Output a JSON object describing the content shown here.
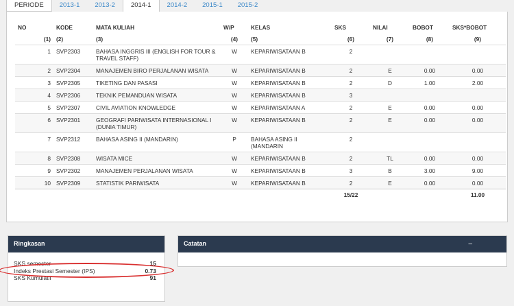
{
  "tabs": [
    "PERIODE",
    "2013-1",
    "2013-2",
    "2014-1",
    "2014-2",
    "2015-1",
    "2015-2"
  ],
  "active_tab": "2014-1",
  "table": {
    "headers": [
      "NO",
      "KODE",
      "MATA KULIAH",
      "W/P",
      "KELAS",
      "SKS",
      "NILAI",
      "BOBOT",
      "SKS*BOBOT"
    ],
    "subheaders": [
      "(1)",
      "(2)",
      "(3)",
      "(4)",
      "(5)",
      "(6)",
      "(7)",
      "(8)",
      "(9)"
    ],
    "rows": [
      {
        "no": "1",
        "kode": "SVP2303",
        "mk": "BAHASA INGGRIS III (ENGLISH FOR TOUR & TRAVEL STAFF)",
        "wp": "W",
        "kelas": "KEPARIWISATAAN B",
        "sks": "2",
        "nilai": "",
        "bobot": "",
        "sb": ""
      },
      {
        "no": "2",
        "kode": "SVP2304",
        "mk": "MANAJEMEN BIRO PERJALANAN WISATA",
        "wp": "W",
        "kelas": "KEPARIWISATAAN B",
        "sks": "2",
        "nilai": "E",
        "bobot": "0.00",
        "sb": "0.00"
      },
      {
        "no": "3",
        "kode": "SVP2305",
        "mk": "TIKETING DAN PASASI",
        "wp": "W",
        "kelas": "KEPARIWISATAAN B",
        "sks": "2",
        "nilai": "D",
        "bobot": "1.00",
        "sb": "2.00"
      },
      {
        "no": "4",
        "kode": "SVP2306",
        "mk": "TEKNIK PEMANDUAN WISATA",
        "wp": "W",
        "kelas": "KEPARIWISATAAN B",
        "sks": "3",
        "nilai": "",
        "bobot": "",
        "sb": ""
      },
      {
        "no": "5",
        "kode": "SVP2307",
        "mk": "CIVIL AVIATION KNOWLEDGE",
        "wp": "W",
        "kelas": "KEPARIWISATAAN A",
        "sks": "2",
        "nilai": "E",
        "bobot": "0.00",
        "sb": "0.00"
      },
      {
        "no": "6",
        "kode": "SVP2301",
        "mk": "GEOGRAFI PARIWISATA INTERNASIONAL I (DUNIA TIMUR)",
        "wp": "W",
        "kelas": "KEPARIWISATAAN B",
        "sks": "2",
        "nilai": "E",
        "bobot": "0.00",
        "sb": "0.00"
      },
      {
        "no": "7",
        "kode": "SVP2312",
        "mk": "BAHASA ASING II (MANDARIN)",
        "wp": "P",
        "kelas": "BAHASA ASING II (MANDARIN",
        "sks": "2",
        "nilai": "",
        "bobot": "",
        "sb": ""
      },
      {
        "no": "8",
        "kode": "SVP2308",
        "mk": "WISATA MICE",
        "wp": "W",
        "kelas": "KEPARIWISATAAN B",
        "sks": "2",
        "nilai": "TL",
        "bobot": "0.00",
        "sb": "0.00"
      },
      {
        "no": "9",
        "kode": "SVP2302",
        "mk": "MANAJEMEN PERJALANAN WISATA",
        "wp": "W",
        "kelas": "KEPARIWISATAAN B",
        "sks": "3",
        "nilai": "B",
        "bobot": "3.00",
        "sb": "9.00"
      },
      {
        "no": "10",
        "kode": "SVP2309",
        "mk": "STATISTIK PARIWISATA",
        "wp": "W",
        "kelas": "KEPARIWISATAAN B",
        "sks": "2",
        "nilai": "E",
        "bobot": "0.00",
        "sb": "0.00"
      }
    ],
    "total_sks": "15/22",
    "total_sb": "11.00"
  },
  "summary": {
    "title": "Ringkasan",
    "items": [
      {
        "label": "SKS semester",
        "value": "15"
      },
      {
        "label": "Indeks Prestasi Semester (IPS)",
        "value": "0.73"
      },
      {
        "label": "SKS Kumulatif",
        "value": "91"
      }
    ]
  },
  "notes": {
    "title": "Catatan",
    "toggle": "–"
  },
  "colors": {
    "header_bg": "#2b3a4f",
    "tab_link": "#3a87c8",
    "highlight": "#d93030"
  }
}
